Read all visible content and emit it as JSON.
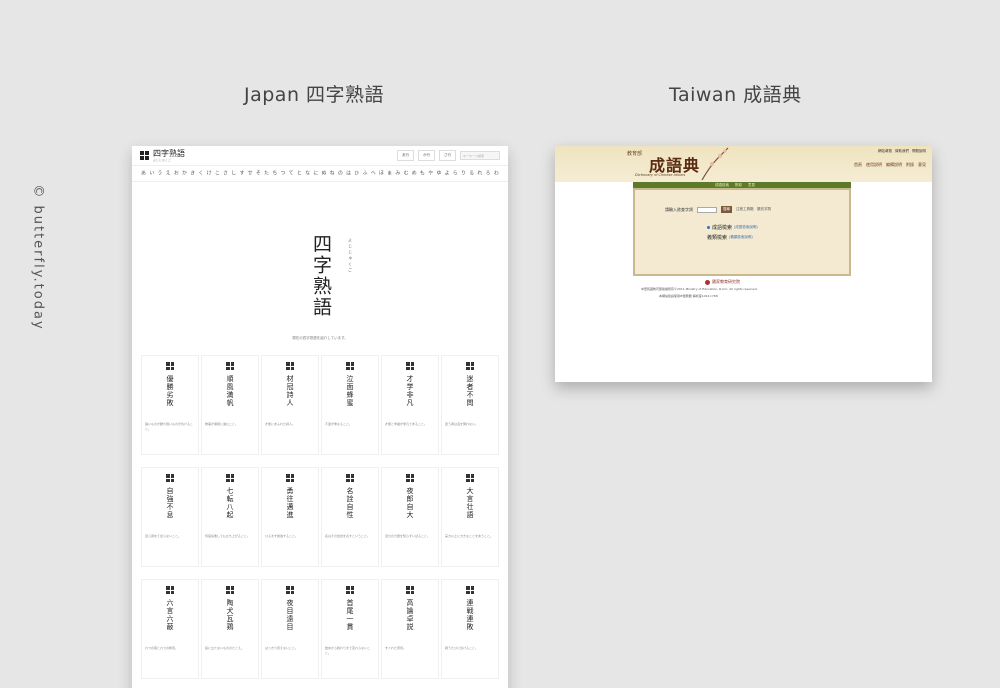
{
  "credit": "© butterfly.today",
  "headings": {
    "japan": "Japan 四字熟語",
    "taiwan": "Taiwan 成語典"
  },
  "japan": {
    "logo_text": "四字熟語",
    "logo_sub": "よじじゅくご",
    "nav": [
      "あ行",
      "か行",
      "さ行"
    ],
    "search_placeholder": "キーワード検索",
    "kana": [
      "あ",
      "い",
      "う",
      "え",
      "お",
      "か",
      "き",
      "く",
      "け",
      "こ",
      "さ",
      "し",
      "す",
      "せ",
      "そ",
      "た",
      "ち",
      "つ",
      "て",
      "と",
      "な",
      "に",
      "ぬ",
      "ね",
      "の",
      "は",
      "ひ",
      "ふ",
      "へ",
      "ほ",
      "ま",
      "み",
      "む",
      "め",
      "も",
      "や",
      "ゆ",
      "よ",
      "ら",
      "り",
      "る",
      "れ",
      "ろ",
      "わ"
    ],
    "hero_title": "四字熟語",
    "hero_reading": "よじじゅくご",
    "hero_note": "現在の四字熟語を紹介しています。",
    "cards": [
      {
        "word": "優勝劣敗",
        "text": "強いものが勝ち弱いものが負けること。"
      },
      {
        "word": "順風満帆",
        "text": "物事が順調に進むこと。"
      },
      {
        "word": "材冠詩人",
        "text": "才能にあふれた詩人。"
      },
      {
        "word": "泣面蜂蜜",
        "text": "不運が重なること。"
      },
      {
        "word": "才学非凡",
        "text": "才能と学識が非凡であること。"
      },
      {
        "word": "迷者不問",
        "text": "迷う者は道を問わない。"
      },
      {
        "word": "自強不息",
        "text": "自ら努めて怠らないこと。"
      },
      {
        "word": "七転八起",
        "text": "何度失敗しても立ち上がること。"
      },
      {
        "word": "勇往邁進",
        "text": "ひるまず前進すること。"
      },
      {
        "word": "名詮自性",
        "text": "名はその性質を表すということ。"
      },
      {
        "word": "夜郎自大",
        "text": "自分の力量を知らずいばること。"
      },
      {
        "word": "大言壮語",
        "text": "実力以上に大きなことを言うこと。"
      },
      {
        "word": "六言六蔽",
        "text": "六つの徳と六つの弊害。"
      },
      {
        "word": "陶犬瓦鶏",
        "text": "役に立たないもののたとえ。"
      },
      {
        "word": "夜目遠目",
        "text": "はっきり見えないこと。"
      },
      {
        "word": "首尾一貫",
        "text": "始めから終わりまで変わらないこと。"
      },
      {
        "word": "高論卓説",
        "text": "すぐれた意見。"
      },
      {
        "word": "連戦連敗",
        "text": "戦うたびに負けること。"
      }
    ]
  },
  "taiwan": {
    "ministry": "教育部",
    "title": "成語典",
    "title_en": "Dictionary of Chinese Idioms",
    "toplinks": [
      "網站導覽",
      "贊助我們",
      "問題說明"
    ],
    "menu": [
      "首頁",
      "使用說明",
      "編輯說明",
      "附錄",
      "意見"
    ],
    "green_bar": [
      "成語檢索",
      "附錄",
      "意見"
    ],
    "search_label": "請輸入欲查字詞",
    "search_button": "搜尋",
    "search_extra": "注音工具箱　擴充字詞",
    "option1": "成語檢索",
    "option1_link": "(成語檢索說明)",
    "option2": "義類檢索",
    "option2_link": "(義類檢索說明)",
    "footer_logo": "國家教育研究院",
    "footer1": "中華民國教育部版權所有©2011 Ministry of Education, R.O.C. All rights reserved.",
    "footer2": "本網站建議使用IE瀏覽器 解析度1024×768"
  }
}
